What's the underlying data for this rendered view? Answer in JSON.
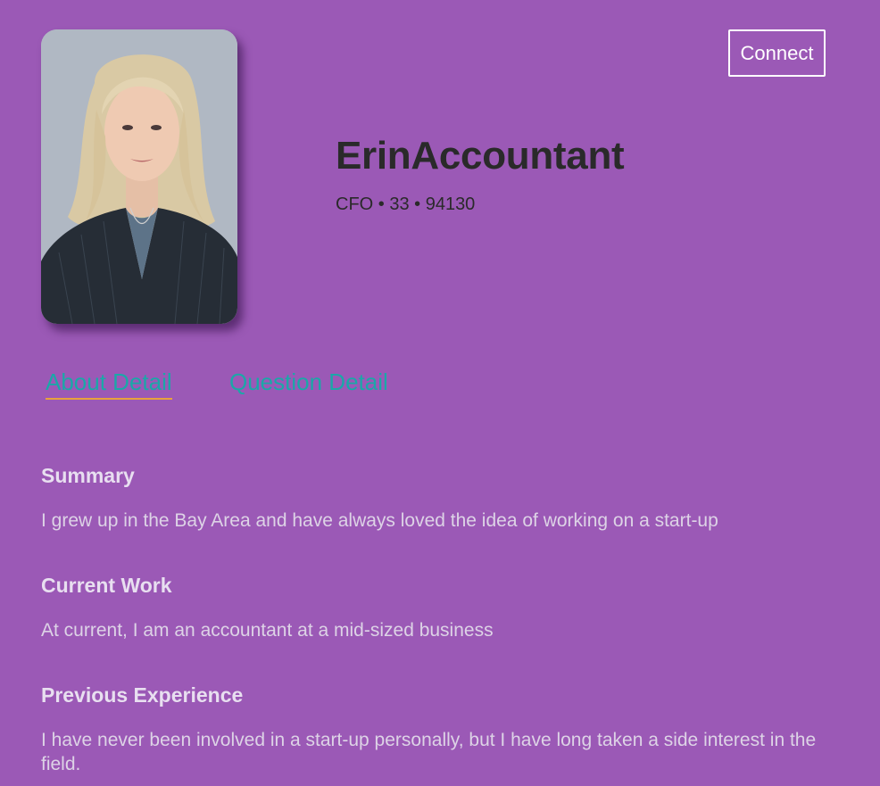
{
  "profile": {
    "photo_alt": "profile photo",
    "name": "ErinAccountant",
    "meta": "CFO • 33 • 94130"
  },
  "actions": {
    "connect_label": "Connect"
  },
  "tabs": [
    {
      "label": "About Detail",
      "active": true
    },
    {
      "label": "Question Detail",
      "active": false
    }
  ],
  "sections": [
    {
      "title": "Summary",
      "text": "I grew up in the Bay Area and have always loved the idea of working on a start-up"
    },
    {
      "title": "Current Work",
      "text": "At current, I am an accountant at a mid-sized business"
    },
    {
      "title": "Previous Experience",
      "text": "I have never been involved in a start-up personally, but I have long taken a side interest in the field."
    }
  ],
  "colors": {
    "background": "#9b59b6",
    "tab_text": "#1aa8a8",
    "tab_underline": "#e8a23c",
    "heading_text": "#2a2a2a",
    "section_text": "#ddd3e6"
  }
}
